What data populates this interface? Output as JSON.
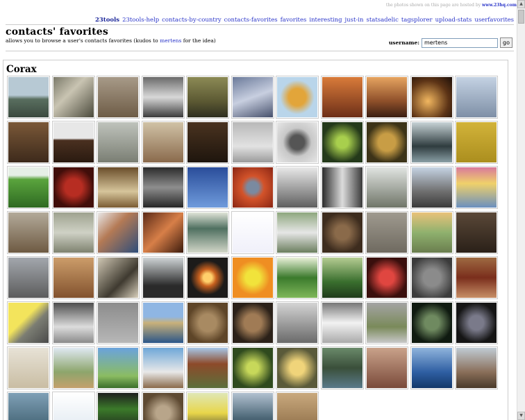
{
  "hosted": {
    "prefix": "the photos shown on this page are hosted by",
    "host": "www.23hq.com"
  },
  "nav": [
    {
      "label": "23tools",
      "active": true
    },
    {
      "label": "23tools-help"
    },
    {
      "label": "contacts-by-country"
    },
    {
      "label": "contacts-favorites"
    },
    {
      "label": "favorites"
    },
    {
      "label": "interesting"
    },
    {
      "label": "just-in"
    },
    {
      "label": "statsadelic"
    },
    {
      "label": "tagsplorer"
    },
    {
      "label": "upload-stats"
    },
    {
      "label": "userfavorites"
    }
  ],
  "header": {
    "title": "contacts' favorites",
    "subtitle_pre": "allows you to browse a user's contacts favorites (kudos to",
    "subtitle_link": "mertens",
    "subtitle_post": "for the idea)"
  },
  "userform": {
    "label": "username:",
    "value": "mertens",
    "button": "go"
  },
  "section": {
    "name": "Corax"
  },
  "thumbnails": [
    {
      "bg": "linear-gradient(#b7c9d4 45%, #596e5f 55%, #3b4a3f)"
    },
    {
      "bg": "linear-gradient(135deg,#7b7a6a,#c9c4b2 40%,#4b4a3c)"
    },
    {
      "bg": "linear-gradient(#a79a88,#6e5c46)"
    },
    {
      "bg": "linear-gradient(#6a6a6a,#d8d8d8 50%,#3c3c3c)"
    },
    {
      "bg": "linear-gradient(#8c8a55,#5c5933 60%,#2f2f20)"
    },
    {
      "bg": "linear-gradient(160deg,#6b7a9a,#c8cfe0 50%,#47516c)"
    },
    {
      "bg": "radial-gradient(circle,#e2a53a 30%,#b9d5ea 60%)"
    },
    {
      "bg": "linear-gradient(#d97b3a,#6d2f18)"
    },
    {
      "bg": "linear-gradient(#e6a460,#8e4f2a 60%,#3a1f12)"
    },
    {
      "bg": "radial-gradient(circle at 40% 60%,#f2b760,#5d3416 60%,#1b0f09)"
    },
    {
      "bg": "linear-gradient(#c4d2e3,#7e8fa6)"
    },
    {
      "bg": "linear-gradient(#7a5838,#3d2a1b)"
    },
    {
      "bg": "linear-gradient(#e7e7e7 40%,#4a3020 45%,#2a1a10)"
    },
    {
      "bg": "linear-gradient(#bfc3bc,#7a7e73)"
    },
    {
      "bg": "linear-gradient(#d0c2a6,#8a6a4c)"
    },
    {
      "bg": "linear-gradient(#4a3320,#1e150d)"
    },
    {
      "bg": "linear-gradient(#b8b8b8,#e2e2e2 60%,#9a9a9a)"
    },
    {
      "bg": "radial-gradient(circle,#555 25%,#c8c8c8 50%,#e6e6e6)"
    },
    {
      "bg": "radial-gradient(circle,#a8cf4d 20%,#24391a 70%)"
    },
    {
      "bg": "radial-gradient(circle,#c89d45 30%,#3c3318 70%)"
    },
    {
      "bg": "linear-gradient(#c7d3d6,#2f3c3f 60%,#8a9fa5)"
    },
    {
      "bg": "linear-gradient(#d2b33a,#ab8e1e)"
    },
    {
      "bg": "linear-gradient(#e6efe6 20%,#5aa43d 30%,#2f6a22)"
    },
    {
      "bg": "radial-gradient(circle,#b72d22 30%,#410e0a 70%)"
    },
    {
      "bg": "linear-gradient(#6a4d2a,#d6c59b 60%,#7a5c34)"
    },
    {
      "bg": "linear-gradient(#2b2b2b,#8e8e8e 50%,#262626)"
    },
    {
      "bg": "linear-gradient(#2a4d9a,#6f9bdc)"
    },
    {
      "bg": "radial-gradient(circle,#7a8aa0 20%,#d3532a 40%,#8a2614)"
    },
    {
      "bg": "linear-gradient(#e8e8e8,#5f5f5f)"
    },
    {
      "bg": "linear-gradient(90deg,#2b2b2b,#dcdcdc 50%,#3a3a3a)"
    },
    {
      "bg": "linear-gradient(#e1e4e1,#6f7568)"
    },
    {
      "bg": "linear-gradient(#c5d3e3,#6f6f6f 60%,#3a3a3a)"
    },
    {
      "bg": "linear-gradient(#d87a9b,#f0d16a 40%,#6a8fbf)"
    },
    {
      "bg": "linear-gradient(#b3aa9a,#6e5a42)"
    },
    {
      "bg": "linear-gradient(#9ea28f,#cfd1c5 50%,#7e826f)"
    },
    {
      "bg": "linear-gradient(135deg,#e8e8e8,#b47a55 40%,#2d4d7a)"
    },
    {
      "bg": "linear-gradient(135deg,#5b2a17,#d77f48 50%,#3c1b0d)"
    },
    {
      "bg": "linear-gradient(#e0e4d8,#4f7060 40%,#d2d6c8)"
    },
    {
      "bg": "linear-gradient(#ffffff,#f0f0fa)"
    },
    {
      "bg": "linear-gradient(#8ea77e,#e6e6e6 50%,#6b7e5e)"
    },
    {
      "bg": "radial-gradient(circle,#8a6a4a 25%,#3d2c1e 70%)"
    },
    {
      "bg": "linear-gradient(#9f9a8f,#6f6a60)"
    },
    {
      "bg": "linear-gradient(#e9c27a,#8fb16e 50%,#6a7d4e)"
    },
    {
      "bg": "linear-gradient(#5a4838,#2a2018)"
    },
    {
      "bg": "linear-gradient(#a3a7ad,#5c5c5c)"
    },
    {
      "bg": "linear-gradient(#cc9d6a,#82522e)"
    },
    {
      "bg": "linear-gradient(135deg,#cfc7b3,#3f3a30 60%,#d9d0bc)"
    },
    {
      "bg": "linear-gradient(#cfd4d6,#2a2a2a 70%)"
    },
    {
      "bg": "radial-gradient(circle,#ffcf6b 15%,#c7601e 30%,#1c1b1a 60%)"
    },
    {
      "bg": "radial-gradient(circle,#f1e33b 25%,#ef8e22 60%)"
    },
    {
      "bg": "linear-gradient(#e9f1d8,#3b7a2c 50%,#7fb75a)"
    },
    {
      "bg": "linear-gradient(#b5cc92,#3a6f2e 60%,#1f3a1a)"
    },
    {
      "bg": "radial-gradient(circle,#e04640 25%,#3a0f0d 70%)"
    },
    {
      "bg": "radial-gradient(circle,#8b8b8b 30%,#3b3b3b 80%)"
    },
    {
      "bg": "linear-gradient(#9e6a42,#7a2e1c 50%,#c78f67)"
    },
    {
      "bg": "linear-gradient(135deg,#f3e45c 40%,#7b7d73 60%,#4a4a4a)"
    },
    {
      "bg": "linear-gradient(#4e4e4e,#dcdcdc 60%,#8a8a8a)"
    },
    {
      "bg": "linear-gradient(#8c8c8c,#b7b7b7)"
    },
    {
      "bg": "linear-gradient(#8fb6e3 35%,#c9b17a 50%,#2b5688)"
    },
    {
      "bg": "radial-gradient(circle,#a88a62 30%,#5e4528 70%)"
    },
    {
      "bg": "radial-gradient(circle,#a07b55 30%,#2b2119 70%)"
    },
    {
      "bg": "linear-gradient(#d4d4d4,#6a6a6a)"
    },
    {
      "bg": "linear-gradient(#777,#f2f2f2 50%,#aaa)"
    },
    {
      "bg": "linear-gradient(#a4a4a4,#7a8a5a 60%,#c8c8c8)"
    },
    {
      "bg": "radial-gradient(circle,#6f8a60 25%,#0f1a10 70%)"
    },
    {
      "bg": "radial-gradient(circle,#7a7a8a 25%,#151515 70%)"
    },
    {
      "bg": "linear-gradient(#e7e2d6,#c9bda3)"
    },
    {
      "bg": "linear-gradient(#dfe9f2,#8da56c 60%,#c4a06c)"
    },
    {
      "bg": "linear-gradient(#6aa3dc,#8bbc62 70%,#3b6f2a)"
    },
    {
      "bg": "linear-gradient(#6ea7d8,#e8e8e8 60%,#8a6a4a)"
    },
    {
      "bg": "linear-gradient(#a7c7e8,#8d4a2a 40%,#5b6f3b)"
    },
    {
      "bg": "radial-gradient(circle,#c7d85a 20%,#2f4a1e 70%)"
    },
    {
      "bg": "radial-gradient(circle,#f0d47a 25%,#5a5a3a 70%)"
    },
    {
      "bg": "linear-gradient(#6a8a6a,#3a4f3a 50%,#5a7a8a)"
    },
    {
      "bg": "linear-gradient(#c9a28a,#7a4a3a)"
    },
    {
      "bg": "linear-gradient(#8fb4dc,#2f5fa3 60%,#13386a)"
    },
    {
      "bg": "linear-gradient(#c0cbd4,#8a6f5a 60%,#4a3a2a)"
    },
    {
      "bg": "linear-gradient(#7fa0b6,#3a5a6a)"
    },
    {
      "bg": "linear-gradient(#ffffff,#dfe8f0)"
    },
    {
      "bg": "linear-gradient(#1e1e1e,#3b7a2a 40%,#1a1a1a)"
    },
    {
      "bg": "radial-gradient(circle,#b8a58a 25%,#5e4a32 70%)"
    },
    {
      "bg": "linear-gradient(#dfe7b6,#e8d64a 50%,#3a3a30)"
    },
    {
      "bg": "linear-gradient(#b2c1d0,#4f6a7a 60%,#233848)"
    },
    {
      "bg": "linear-gradient(#c9a97e,#8a6a44)"
    }
  ]
}
